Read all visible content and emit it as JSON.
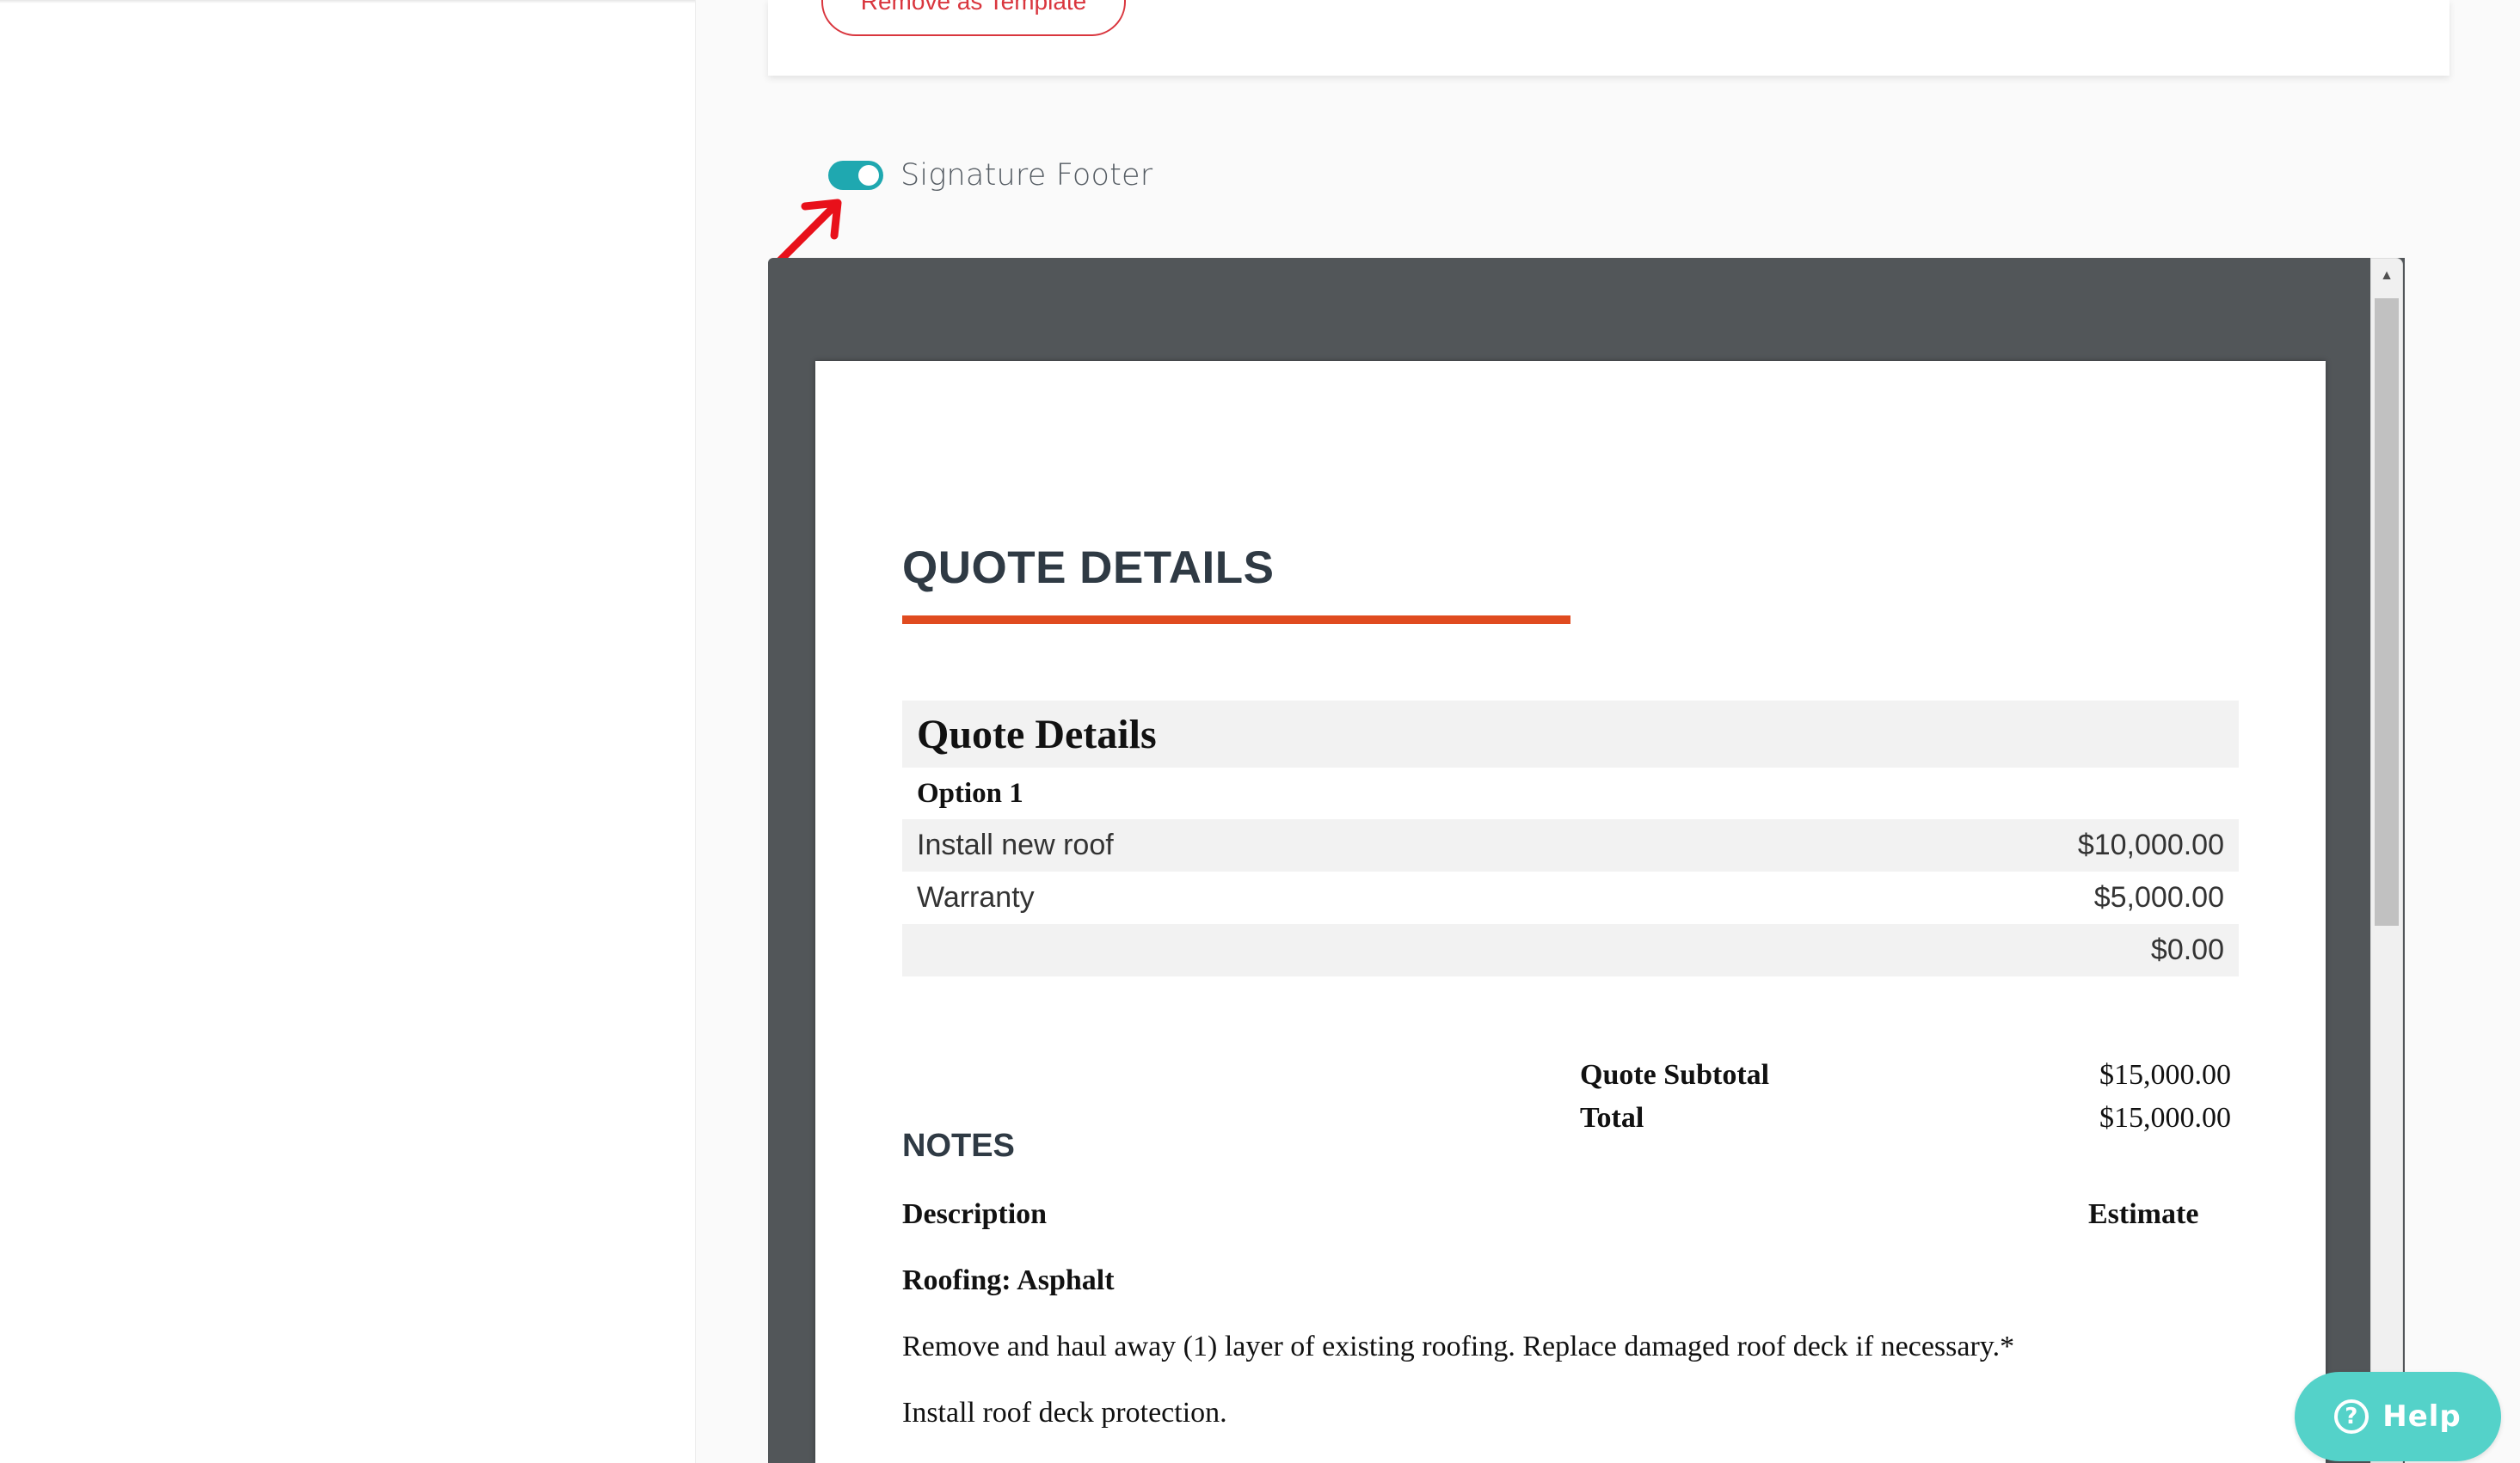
{
  "template_card": {
    "remove_template_label": "Remove as Template"
  },
  "signature_footer": {
    "label": "Signature Footer",
    "enabled": true
  },
  "preview": {
    "doc_title": "QUOTE DETAILS",
    "table": {
      "heading": "Quote Details",
      "option_label": "Option 1",
      "rows": [
        {
          "description": "Install new roof",
          "price": "$10,000.00"
        },
        {
          "description": "Warranty",
          "price": "$5,000.00"
        },
        {
          "description": "",
          "price": "$0.00"
        }
      ]
    },
    "summary": {
      "subtotal_label": "Quote Subtotal",
      "subtotal_value": "$15,000.00",
      "total_label": "Total",
      "total_value": "$15,000.00"
    },
    "notes": {
      "heading": "NOTES",
      "col_description": "Description",
      "col_estimate": "Estimate",
      "item_title": "Roofing: Asphalt",
      "lines": [
        "Remove and haul away (1) layer of existing roofing. Replace damaged roof deck if necessary.*",
        "Install roof deck protection."
      ]
    }
  },
  "help_button": {
    "label": "Help"
  },
  "colors": {
    "toggle_on": "#1fa8b0",
    "danger": "#d9363e",
    "title_underline": "#e04b1f",
    "help": "#54d2c9",
    "annotation_arrow": "#e8101a"
  },
  "icons": {
    "annotation": "red-arrow-icon",
    "help": "question-circle-icon",
    "scroll_up": "scroll-up-arrow-icon"
  }
}
